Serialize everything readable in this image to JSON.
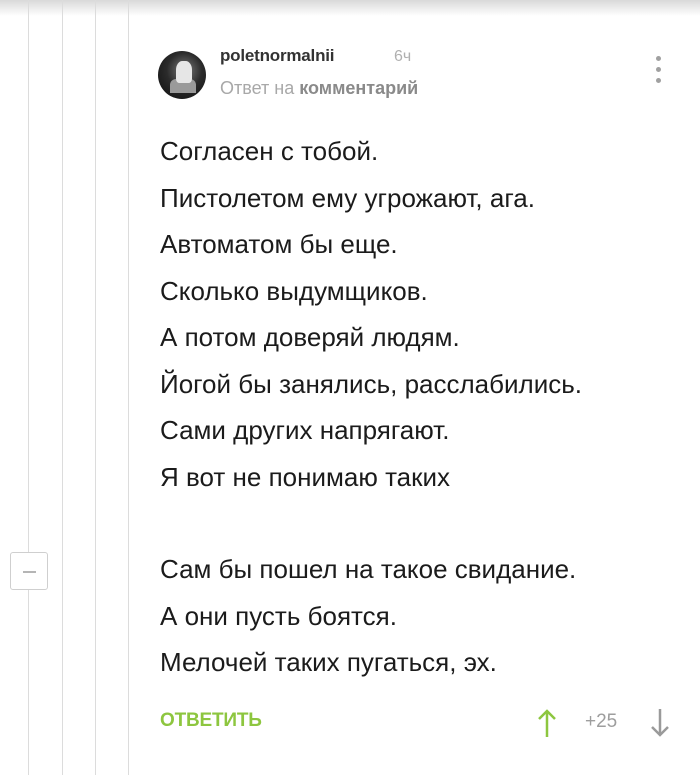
{
  "comment": {
    "author": "poletnormalnii",
    "time": "6ч",
    "reply_to_prefix": "Ответ на",
    "reply_to_link": "комментарий",
    "lines": [
      "Согласен с тобой.",
      "Пистолетом ему угрожают, ага.",
      "Автоматом бы еще.",
      "Сколько выдумщиков.",
      "А потом доверяй людям.",
      "Йогой бы занялись, расслабились.",
      "Сами других напрягают.",
      "Я вот не понимаю таких"
    ],
    "lines2": [
      "Сам бы пошел на такое свидание.",
      "А они пусть боятся.",
      "Мелочей таких пугаться, эх."
    ],
    "reply_label": "ОТВЕТИТЬ",
    "score": "+25"
  },
  "colors": {
    "accent_green": "#8dc63f",
    "text": "#1b1b1b",
    "muted": "#a8a8a8"
  },
  "icons": [
    "avatar",
    "more-vertical-icon",
    "collapse-icon",
    "arrow-up-icon",
    "arrow-down-icon"
  ]
}
